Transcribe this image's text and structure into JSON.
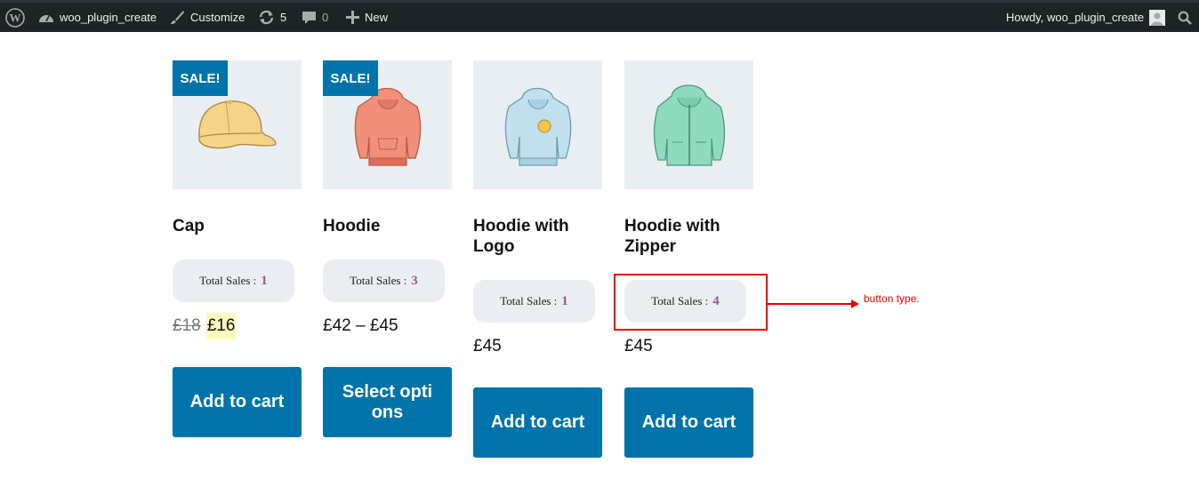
{
  "adminbar": {
    "icons": {
      "wp": "wordpress-logo-icon",
      "dashboard": "dashboard-icon",
      "customize": "brush-icon",
      "updates": "updates-icon",
      "comments": "comment-icon",
      "new": "plus-icon",
      "search": "search-icon"
    },
    "site_name": "woo_plugin_create",
    "customize": "Customize",
    "updates_count": "5",
    "comments_count": "0",
    "new_label": "New",
    "howdy": "Howdy, woo_plugin_create"
  },
  "products": [
    {
      "name": "Cap",
      "sale_badge": "SALE!",
      "sales_label": "Total Sales :",
      "sales_count": "1",
      "price_old": "£18",
      "price_new": "£16",
      "button": "Add to cart",
      "image": "cap"
    },
    {
      "name": "Hoodie",
      "sale_badge": "SALE!",
      "sales_label": "Total Sales :",
      "sales_count": "3",
      "price": "£42 – £45",
      "button": "Select options",
      "image": "hoodie"
    },
    {
      "name": "Hoodie with Logo",
      "sales_label": "Total Sales :",
      "sales_count": "1",
      "price": "£45",
      "button": "Add to cart",
      "image": "hoodie-logo"
    },
    {
      "name": "Hoodie with Zipper",
      "sales_label": "Total Sales :",
      "sales_count": "4",
      "price": "£45",
      "button": "Add to cart",
      "image": "hoodie-zipper"
    }
  ],
  "annotation": {
    "text": "button type."
  },
  "colors": {
    "adminbar": "#1d2327",
    "button": "#0073aa",
    "sale": "#0073aa",
    "pill": "#eaeef2",
    "count": "#96588a",
    "annotation": "#e60000"
  }
}
